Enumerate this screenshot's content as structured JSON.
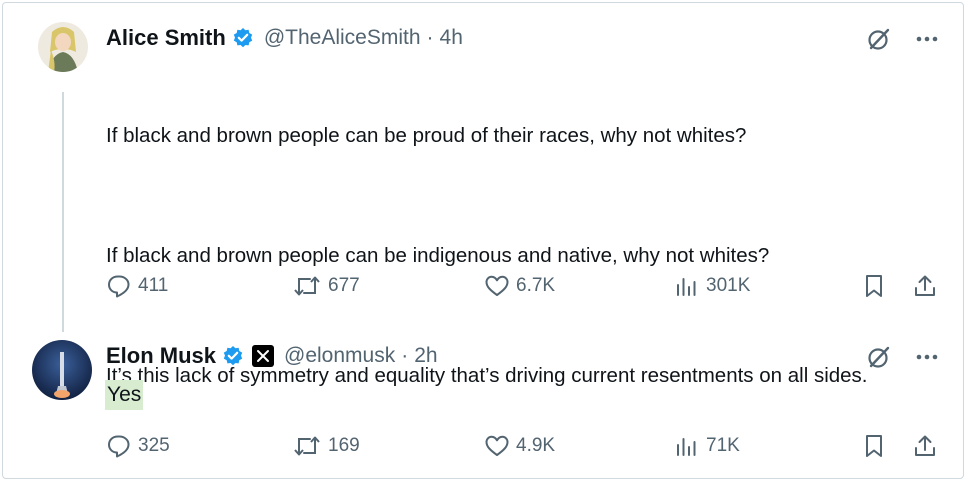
{
  "tweets": [
    {
      "author": {
        "name": "Alice Smith",
        "handle": "@TheAliceSmith",
        "time": "4h",
        "verified": true
      },
      "paragraphs": [
        "If black and brown people can be proud of their races, why not whites?",
        "If black and brown people can be indigenous and native, why not whites?",
        "It’s this lack of symmetry and equality that’s driving current resentments on all sides."
      ],
      "stats": {
        "replies": "411",
        "reposts": "677",
        "likes": "6.7K",
        "views": "301K"
      }
    },
    {
      "author": {
        "name": "Elon Musk",
        "handle": "@elonmusk",
        "time": "2h",
        "verified": true,
        "affiliate_badge": "X"
      },
      "text": "Yes",
      "stats": {
        "replies": "325",
        "reposts": "169",
        "likes": "4.9K",
        "views": "71K"
      }
    }
  ],
  "separator": "·",
  "colors": {
    "verified": "#1d9bf0",
    "muted": "#536471",
    "highlight": "#d8ecd0"
  },
  "icons": [
    "verified-badge-icon",
    "grok-icon",
    "more-icon",
    "reply-icon",
    "repost-icon",
    "like-icon",
    "views-icon",
    "bookmark-icon",
    "share-icon"
  ]
}
